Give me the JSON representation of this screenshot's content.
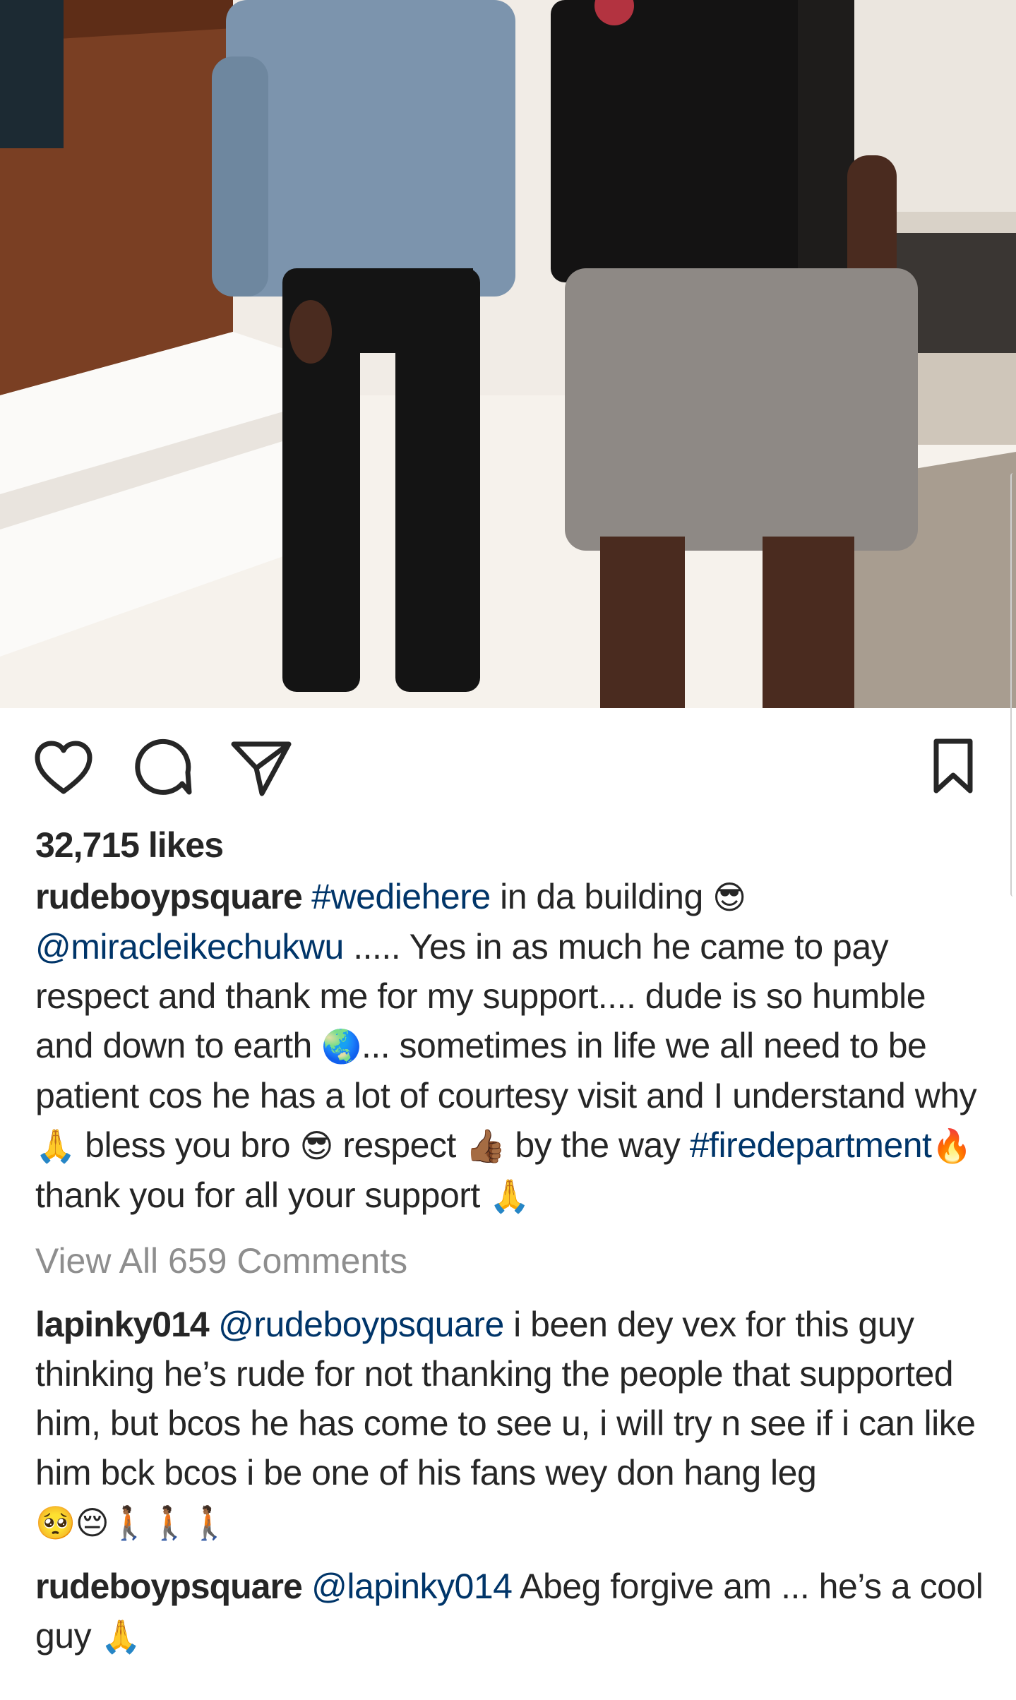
{
  "post": {
    "likes_text": "32,715 likes",
    "caption": {
      "username": "rudeboypsquare",
      "segments": [
        {
          "type": "tag",
          "text": "#wediehere"
        },
        {
          "type": "text",
          "text": " in da building "
        },
        {
          "type": "emoji",
          "text": "😎"
        },
        {
          "type": "text",
          "text": " "
        },
        {
          "type": "mention",
          "text": "@miracleikechukwu"
        },
        {
          "type": "text",
          "text": " ..... Yes in as much he came to pay respect and thank me for my support.... dude is so humble and down to earth "
        },
        {
          "type": "emoji",
          "text": "🌏"
        },
        {
          "type": "text",
          "text": "... sometimes in life we all need to be patient cos he has a lot of courtesy visit and I understand why "
        },
        {
          "type": "emoji",
          "text": "🙏"
        },
        {
          "type": "text",
          "text": " bless you bro "
        },
        {
          "type": "emoji",
          "text": "😎"
        },
        {
          "type": "text",
          "text": " respect "
        },
        {
          "type": "emoji",
          "text": "👍🏾"
        },
        {
          "type": "text",
          "text": " by the way "
        },
        {
          "type": "tag",
          "text": "#firedepartment"
        },
        {
          "type": "emoji",
          "text": "🔥"
        },
        {
          "type": "text",
          "text": " thank you for all your support "
        },
        {
          "type": "emoji",
          "text": "🙏"
        }
      ]
    },
    "view_all_comments": "View All 659 Comments",
    "comments": [
      {
        "username": "lapinky014",
        "segments": [
          {
            "type": "mention",
            "text": "@rudeboypsquare"
          },
          {
            "type": "text",
            "text": " i been dey vex for this guy thinking he’s rude for not thanking the people that supported him, but bcos he has come to see u, i will try n see if i can like him bck bcos i be one of his fans wey don hang leg"
          },
          {
            "type": "emoji",
            "text": "🥺😔🚶🏾🚶🏾🚶🏾"
          }
        ]
      },
      {
        "username": "rudeboypsquare",
        "segments": [
          {
            "type": "mention",
            "text": "@lapinky014"
          },
          {
            "type": "text",
            "text": " Abeg forgive am ... he’s a cool guy "
          },
          {
            "type": "emoji",
            "text": "🙏"
          }
        ]
      }
    ]
  },
  "icons": {
    "like": "heart-icon",
    "comment": "comment-bubble-icon",
    "share": "paper-plane-icon",
    "save": "bookmark-icon"
  },
  "colors": {
    "text": "#262626",
    "link": "#003569",
    "muted": "#8e8e8e"
  }
}
